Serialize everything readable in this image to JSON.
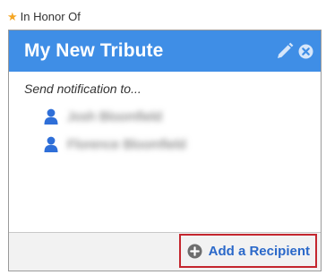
{
  "honor": {
    "label": "In Honor Of",
    "icon": "star-icon"
  },
  "card": {
    "title": "My New Tribute",
    "header_color": "#3f8ee6",
    "notify_label": "Send notification to...",
    "recipients": [
      {
        "name": "Josh Bloomfield",
        "icon": "user-icon"
      },
      {
        "name": "Florence Bloomfield",
        "icon": "user-icon"
      }
    ],
    "footer": {
      "add_label": "Add a Recipient",
      "icon": "plus-circle-icon"
    }
  },
  "colors": {
    "accent": "#3f8ee6",
    "link": "#2a68c9",
    "highlight_border": "#c4262e",
    "star": "#f5a623"
  }
}
